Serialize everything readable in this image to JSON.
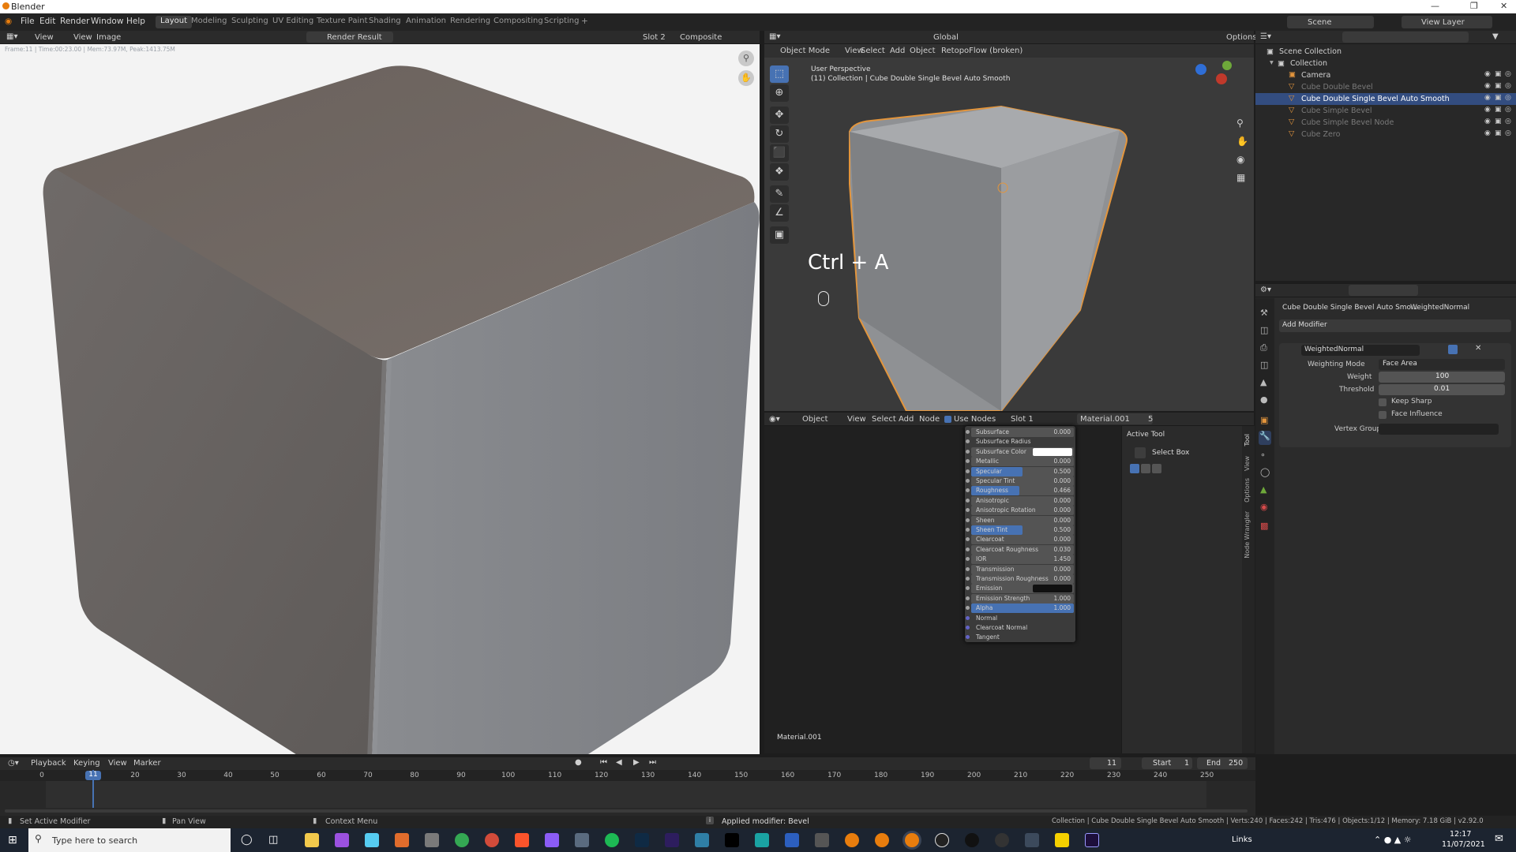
{
  "window": {
    "title": "Blender"
  },
  "menus": [
    "File",
    "Edit",
    "Render",
    "Window",
    "Help"
  ],
  "workspaces": [
    "Layout",
    "Modeling",
    "Sculpting",
    "UV Editing",
    "Texture Paint",
    "Shading",
    "Animation",
    "Rendering",
    "Compositing",
    "Scripting"
  ],
  "scene": {
    "name": "Scene",
    "view_layer": "View Layer"
  },
  "image_editor": {
    "menus": [
      "View",
      "View",
      "Image"
    ],
    "image_name": "Render Result",
    "slot": "Slot 2",
    "pass": "Composite",
    "info": "Frame:11 | Time:00:23.00 | Mem:73.97M, Peak:1413.75M"
  },
  "viewport": {
    "mode": "Object Mode",
    "menus": [
      "View",
      "Select",
      "Add",
      "Object"
    ],
    "addon_menu": "RetopoFlow (broken)",
    "orientation": "Global",
    "options": "Options",
    "perspective": "User Perspective",
    "collection_info": "(11) Collection | Cube Double Single Bevel Auto Smooth",
    "shortcut_overlay": "Ctrl + A"
  },
  "node_editor": {
    "type": "Object",
    "menus": [
      "View",
      "Select",
      "Add",
      "Node"
    ],
    "use_nodes": "Use Nodes",
    "slot": "Slot 1",
    "material": "Material.001",
    "users": "5",
    "footer_label": "Material.001",
    "rows": [
      {
        "label": "Subsurface",
        "value": "0.000",
        "fill": 0
      },
      {
        "label": "Subsurface Radius",
        "value": "",
        "fill": 0
      },
      {
        "label": "Subsurface Color",
        "value": "",
        "fill": 0
      },
      {
        "label": "Metallic",
        "value": "0.000",
        "fill": 0
      },
      {
        "label": "Specular",
        "value": "0.500",
        "fill": 0.5
      },
      {
        "label": "Specular Tint",
        "value": "0.000",
        "fill": 0
      },
      {
        "label": "Roughness",
        "value": "0.466",
        "fill": 0.466
      },
      {
        "label": "Anisotropic",
        "value": "0.000",
        "fill": 0
      },
      {
        "label": "Anisotropic Rotation",
        "value": "0.000",
        "fill": 0
      },
      {
        "label": "Sheen",
        "value": "0.000",
        "fill": 0
      },
      {
        "label": "Sheen Tint",
        "value": "0.500",
        "fill": 0.5
      },
      {
        "label": "Clearcoat",
        "value": "0.000",
        "fill": 0
      },
      {
        "label": "Clearcoat Roughness",
        "value": "0.030",
        "fill": 0
      },
      {
        "label": "IOR",
        "value": "1.450",
        "fill": 0
      },
      {
        "label": "Transmission",
        "value": "0.000",
        "fill": 0
      },
      {
        "label": "Transmission Roughness",
        "value": "0.000",
        "fill": 0
      },
      {
        "label": "Emission",
        "value": "",
        "fill": 0
      },
      {
        "label": "Emission Strength",
        "value": "1.000",
        "fill": 0
      },
      {
        "label": "Alpha",
        "value": "1.000",
        "fill": 1
      },
      {
        "label": "Normal",
        "value": "",
        "fill": 0
      },
      {
        "label": "Clearcoat Normal",
        "value": "",
        "fill": 0
      },
      {
        "label": "Tangent",
        "value": "",
        "fill": 0
      }
    ],
    "side_tabs": [
      "Tool",
      "View",
      "Options",
      "Node Wrangler"
    ],
    "active_tool": {
      "header": "Active Tool",
      "name": "Select Box"
    }
  },
  "outliner": {
    "root": "Scene Collection",
    "collection": "Collection",
    "items": [
      {
        "name": "Camera",
        "active": false,
        "dim": false
      },
      {
        "name": "Cube Double Bevel",
        "active": false,
        "dim": true
      },
      {
        "name": "Cube Double Single Bevel Auto Smooth",
        "active": true,
        "dim": false
      },
      {
        "name": "Cube Simple Bevel",
        "active": false,
        "dim": true
      },
      {
        "name": "Cube Simple Bevel Node",
        "active": false,
        "dim": true
      },
      {
        "name": "Cube Zero",
        "active": false,
        "dim": true
      }
    ]
  },
  "properties": {
    "object_name": "Cube Double Single Bevel Auto Smo...",
    "modifier_name_header": "WeightedNormal",
    "add_modifier": "Add Modifier",
    "modifier": {
      "name": "WeightedNormal",
      "weighting_mode_label": "Weighting Mode",
      "weighting_mode": "Face Area",
      "weight_label": "Weight",
      "weight": "100",
      "threshold_label": "Threshold",
      "threshold": "0.01",
      "keep_sharp": "Keep Sharp",
      "face_influence": "Face Influence",
      "vertex_group_label": "Vertex Group"
    }
  },
  "timeline": {
    "menus": [
      "Playback",
      "Keying",
      "View",
      "Marker"
    ],
    "current_frame": "11",
    "start_label": "Start",
    "start": "1",
    "end_label": "End",
    "end": "250",
    "ticks": [
      "0",
      "20",
      "30",
      "40",
      "50",
      "60",
      "70",
      "80",
      "90",
      "100",
      "110",
      "120",
      "130",
      "140",
      "150",
      "160",
      "170",
      "180",
      "190",
      "200",
      "210",
      "220",
      "230",
      "240",
      "250"
    ]
  },
  "statusbar": {
    "left1": "Set Active Modifier",
    "left2": "Pan View",
    "left3": "Context Menu",
    "message": "Applied modifier: Bevel",
    "right": "Collection | Cube Double Single Bevel Auto Smooth | Verts:240 | Faces:242 | Tris:476 | Objects:1/12 | Memory: 7.18 GiB | v2.92.0"
  },
  "taskbar": {
    "search_placeholder": "Type here to search",
    "links": "Links",
    "time": "12:17",
    "date": "11/07/2021"
  },
  "colors": {
    "accent": "#4772b3",
    "selection_outline": "#e3953c",
    "active_row": "#334d80"
  }
}
